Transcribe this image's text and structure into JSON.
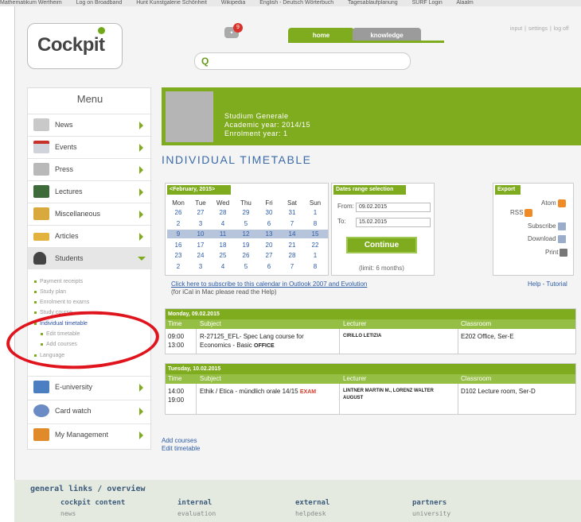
{
  "bookmarks": [
    "Mathematikum Wertheim",
    "Log on Broadband",
    "Hunt Kunstgalerie Schönheit",
    "Wikipedia",
    "English - Deutsch Wörterbuch",
    "Tagesablaufplanung",
    "SURF Login",
    "Alaalm"
  ],
  "brand": {
    "logo_text": "Cockpit"
  },
  "search": {
    "placeholder": ""
  },
  "notifications": {
    "count": "9"
  },
  "tabs": {
    "home": "home",
    "knowledge": "knowledge"
  },
  "toplinks": [
    "input",
    "settings",
    "log off"
  ],
  "menu": {
    "title": "Menu",
    "items": [
      {
        "label": "News"
      },
      {
        "label": "Events"
      },
      {
        "label": "Press"
      },
      {
        "label": "Lectures"
      },
      {
        "label": "Miscellaneous"
      },
      {
        "label": "Articles"
      },
      {
        "label": "Students"
      }
    ],
    "student_sub": [
      "Payment receipts",
      "Study plan",
      "Enrolment to exams",
      "Study course",
      "Individual timetable",
      "Edit timetable",
      "Add courses",
      "Language"
    ],
    "items_after": [
      {
        "label": "E-university"
      },
      {
        "label": "Card watch"
      },
      {
        "label": "My Management"
      }
    ]
  },
  "profile": {
    "program": "Studium Generale",
    "academic_year": "Academic year: 2014/15",
    "enrolment_year": "Enrolment year: 1"
  },
  "page_title": "INDIVIDUAL TIMETABLE",
  "calendar": {
    "month_label": "<February, 2015>",
    "days": [
      "Mon",
      "Tue",
      "Wed",
      "Thu",
      "Fri",
      "Sat",
      "Sun"
    ],
    "weeks": [
      [
        "26",
        "27",
        "28",
        "29",
        "30",
        "31",
        "1"
      ],
      [
        "2",
        "3",
        "4",
        "5",
        "6",
        "7",
        "8"
      ],
      [
        "9",
        "10",
        "11",
        "12",
        "13",
        "14",
        "15"
      ],
      [
        "16",
        "17",
        "18",
        "19",
        "20",
        "21",
        "22"
      ],
      [
        "23",
        "24",
        "25",
        "26",
        "27",
        "28",
        "1"
      ],
      [
        "2",
        "3",
        "4",
        "5",
        "6",
        "7",
        "8"
      ]
    ],
    "highlighted_week": 2
  },
  "dates_range": {
    "title": "Dates range selection",
    "from_label": "From:",
    "from_value": "09.02.2015",
    "to_label": "To:",
    "to_value": "15.02.2015",
    "continue_label": "Continue",
    "limit_note": "(limit: 6 months)"
  },
  "export": {
    "title": "Export",
    "atom": "Atom",
    "rss": "RSS",
    "subscribe": "Subscribe",
    "download": "Download",
    "print": "Print"
  },
  "subscribe_link": "Click here to subscribe to this calendar in Outlook 2007 and Evolution",
  "subscribe_note": "(for iCal in Mac please read the Help)",
  "help_link": "Help - Tutorial",
  "timetable": {
    "headers": {
      "time": "Time",
      "subject": "Subject",
      "lecturer": "Lecturer",
      "classroom": "Classroom"
    },
    "days": [
      {
        "day": "Monday, 09.02.2015",
        "time_start": "09:00",
        "time_end": "13:00",
        "subject_line1": "R-27125_EFL- Spec Lang course for",
        "subject_line2": "Economics - Basic",
        "tag": "OFFICE",
        "lecturer": "CIRILLO LETIZIA",
        "classroom": "E202 Office, Ser-E"
      },
      {
        "day": "Tuesday, 10.02.2015",
        "time_start": "14:00",
        "time_end": "19:00",
        "subject_line1": "Ethik / Etica - mündlich orale 14/15",
        "tag": "EXAM",
        "lecturer_line1": "LINTNER MARTIN M., LORENZ WALTER",
        "lecturer_line2": "AUGUST",
        "classroom": "D102 Lecture room, Ser-D"
      }
    ]
  },
  "bottom_links": {
    "add_courses": "Add courses",
    "edit_timetable": "Edit timetable"
  },
  "footer": {
    "title": "general links / overview",
    "columns": [
      {
        "heading": "cockpit content",
        "item": "news"
      },
      {
        "heading": "internal",
        "item": "evaluation"
      },
      {
        "heading": "external",
        "item": "helpdesk"
      },
      {
        "heading": "partners",
        "item": "university"
      }
    ]
  },
  "colors": {
    "accent": "#7fab1e",
    "link": "#2c5ca6",
    "annotation": "#e0141d"
  }
}
